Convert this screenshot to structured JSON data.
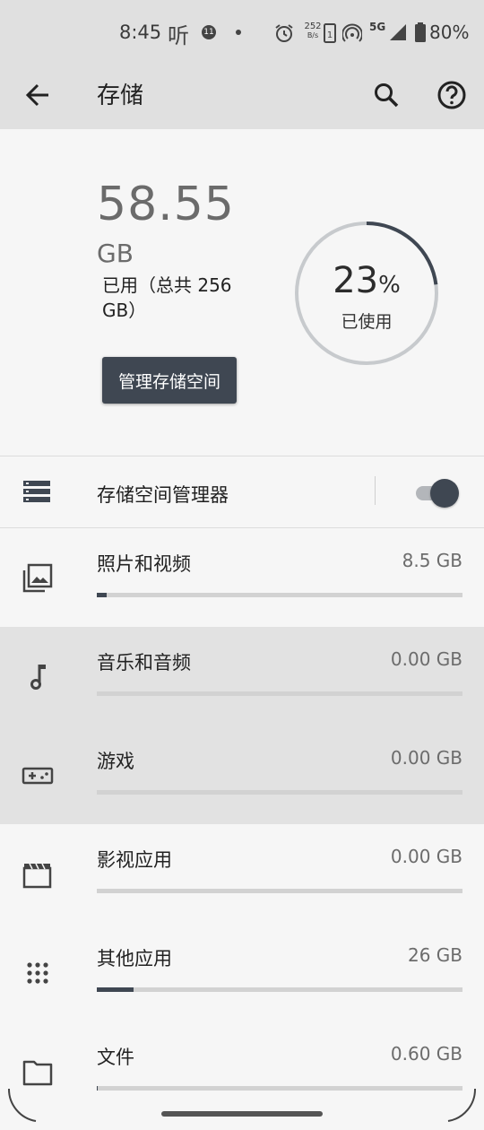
{
  "status_bar": {
    "time": "8:45",
    "ting_badge": "听",
    "notif_count": "11",
    "net_speed": "252",
    "net_unit": "B/s",
    "network": "5G",
    "battery": "80%"
  },
  "appbar": {
    "title": "存储",
    "back_icon": "arrow-back-icon",
    "search_icon": "search-icon",
    "help_icon": "help-icon"
  },
  "summary": {
    "used_value": "58.55",
    "used_unit": "GB",
    "used_total_text": "已用（总共 256 GB）",
    "manage_button": "管理存储空间",
    "percent": "23",
    "percent_sign": "%",
    "percent_label": "已使用",
    "ring_fraction": 0.23
  },
  "storage_manager": {
    "label": "存储空间管理器",
    "enabled": true
  },
  "categories": [
    {
      "name": "照片和视频",
      "size": "8.5 GB",
      "fraction": 0.028,
      "icon": "photo-library-icon",
      "highlighted": false
    },
    {
      "name": "音乐和音频",
      "size": "0.00 GB",
      "fraction": 0,
      "icon": "music-note-icon",
      "highlighted": true
    },
    {
      "name": "游戏",
      "size": "0.00 GB",
      "fraction": 0,
      "icon": "gamepad-icon",
      "highlighted": true
    },
    {
      "name": "影视应用",
      "size": "0.00 GB",
      "fraction": 0,
      "icon": "movie-icon",
      "highlighted": false
    },
    {
      "name": "其他应用",
      "size": "26 GB",
      "fraction": 0.1,
      "icon": "apps-grid-icon",
      "highlighted": false
    },
    {
      "name": "文件",
      "size": "0.60 GB",
      "fraction": 0.002,
      "icon": "folder-icon",
      "highlighted": false
    }
  ],
  "colors": {
    "accent": "#3f4752",
    "ring_track": "#c7cacd",
    "bar_track": "#d2d2d2",
    "highlight": "#e2e2e2"
  }
}
